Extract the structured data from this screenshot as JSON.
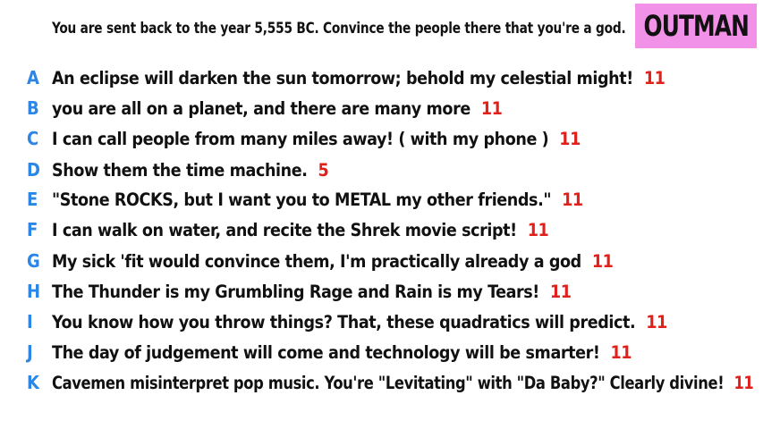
{
  "prompt": "You are sent back to the year 5,555 BC. Convince the people there that you're a god.",
  "badge": {
    "text": "OUTMAN",
    "color": "#f291e8"
  },
  "colors": {
    "letter": "#2b86e6",
    "score": "#e0201b",
    "text": "#111111"
  },
  "answers": [
    {
      "letter": "A",
      "text": "An eclipse will darken the sun tomorrow; behold my celestial might!",
      "score": "11"
    },
    {
      "letter": "B",
      "text": "you are all on a planet, and there are many more",
      "score": "11"
    },
    {
      "letter": "C",
      "text": "I can call people from many miles away! ( with my phone )",
      "score": "11"
    },
    {
      "letter": "D",
      "text": "Show them the time machine.",
      "score": "5"
    },
    {
      "letter": "E",
      "text": "\"Stone ROCKS, but I want you to METAL my other friends.\"",
      "score": "11"
    },
    {
      "letter": "F",
      "text": "I can walk on water, and recite the Shrek movie script!",
      "score": "11"
    },
    {
      "letter": "G",
      "text": "My sick 'fit would convince them, I'm practically already a god",
      "score": "11"
    },
    {
      "letter": "H",
      "text": "The Thunder is my Grumbling Rage and Rain is my Tears!",
      "score": "11"
    },
    {
      "letter": "I",
      "text": "You know how you throw things? That, these quadratics will predict.",
      "score": "11"
    },
    {
      "letter": "J",
      "text": "The day of judgement will come and technology will be smarter!",
      "score": "11"
    },
    {
      "letter": "K",
      "text": "Cavemen misinterpret pop music. You're \"Levitating\" with \"Da Baby?\" Clearly divine!",
      "score": "11"
    }
  ]
}
